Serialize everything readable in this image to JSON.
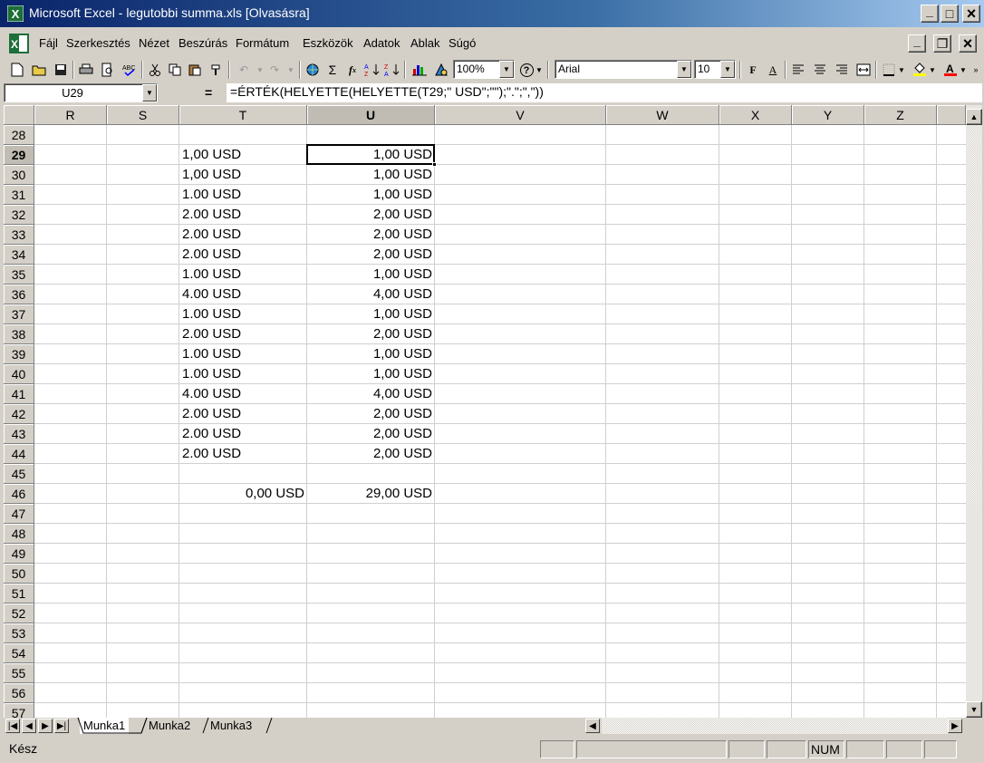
{
  "window": {
    "title": "Microsoft Excel - legutobbi summa.xls  [Olvasásra]",
    "minimize": "_",
    "maximize": "□",
    "close": "×",
    "doc_minimize": "_",
    "doc_restore": "❐",
    "doc_close": "×"
  },
  "menu": [
    {
      "label": "Fájl",
      "key": "F"
    },
    {
      "label": "Szerkesztés",
      "key": "S"
    },
    {
      "label": "Nézet",
      "key": "N"
    },
    {
      "label": "Beszúrás",
      "key": "B"
    },
    {
      "label": "Formátum",
      "key": "á"
    },
    {
      "label": "Eszközök",
      "key": "E"
    },
    {
      "label": "Adatok",
      "key": "d"
    },
    {
      "label": "Ablak",
      "key": "A"
    },
    {
      "label": "Súgó",
      "key": "S"
    }
  ],
  "toolbar": {
    "zoom": "100%",
    "font": "Arial",
    "size": "10",
    "bold": "F",
    "italic": "A",
    "sum": "Σ",
    "fx": "f",
    "help": "?"
  },
  "formula_bar": {
    "name_box": "U29",
    "equals": "=",
    "formula": "=ÉRTÉK(HELYETTE(HELYETTE(T29;\" USD\";\"\");\".\";\",\"))"
  },
  "columns": [
    "R",
    "S",
    "T",
    "U",
    "V",
    "W",
    "X",
    "Y",
    "Z"
  ],
  "selected_column": "U",
  "rows": [
    "28",
    "29",
    "30",
    "31",
    "32",
    "33",
    "34",
    "35",
    "36",
    "37",
    "38",
    "39",
    "40",
    "41",
    "42",
    "43",
    "44",
    "45",
    "46",
    "47",
    "48",
    "49",
    "50",
    "51",
    "52",
    "53",
    "54",
    "55",
    "56",
    "57"
  ],
  "selected_row": "29",
  "cells": {
    "T": [
      "",
      "1,00 USD",
      "1,00 USD",
      "1.00 USD",
      "2.00 USD",
      "2.00 USD",
      "2.00 USD",
      "1.00 USD",
      "4.00 USD",
      "1.00 USD",
      "2.00 USD",
      "1.00 USD",
      "1.00 USD",
      "4.00 USD",
      "2.00 USD",
      "2.00 USD",
      "2.00 USD",
      "",
      "0,00 USD"
    ],
    "U": [
      "",
      "1,00 USD",
      "1,00 USD",
      "1,00 USD",
      "2,00 USD",
      "2,00 USD",
      "2,00 USD",
      "1,00 USD",
      "4,00 USD",
      "1,00 USD",
      "2,00 USD",
      "1,00 USD",
      "1,00 USD",
      "4,00 USD",
      "2,00 USD",
      "2,00 USD",
      "2,00 USD",
      "",
      "29,00 USD"
    ]
  },
  "sheets": [
    "Munka1",
    "Munka2",
    "Munka3"
  ],
  "active_sheet": "Munka1",
  "status": {
    "text": "Kész",
    "num": "NUM"
  }
}
